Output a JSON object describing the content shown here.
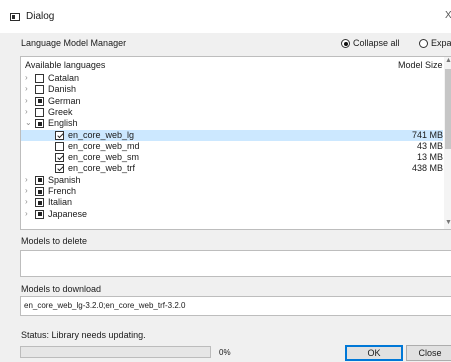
{
  "window": {
    "title": "Dialog",
    "close_glyph": "X"
  },
  "header": {
    "label": "Language Model Manager",
    "collapse_label": "Collapse all",
    "expand_label": "Expand all"
  },
  "tree": {
    "column_label": "Available languages",
    "column_size": "Model Size",
    "rows": [
      {
        "depth": 0,
        "chevron": ">",
        "check": "unchecked",
        "label": "Catalan",
        "size": ""
      },
      {
        "depth": 0,
        "chevron": ">",
        "check": "unchecked",
        "label": "Danish",
        "size": ""
      },
      {
        "depth": 0,
        "chevron": ">",
        "check": "partial",
        "label": "German",
        "size": ""
      },
      {
        "depth": 0,
        "chevron": ">",
        "check": "unchecked",
        "label": "Greek",
        "size": ""
      },
      {
        "depth": 0,
        "chevron": "v",
        "check": "partial",
        "label": "English",
        "size": ""
      },
      {
        "depth": 1,
        "chevron": "",
        "check": "checked",
        "label": "en_core_web_lg",
        "size": "741 MB",
        "selected": true
      },
      {
        "depth": 1,
        "chevron": "",
        "check": "unchecked",
        "label": "en_core_web_md",
        "size": "43 MB"
      },
      {
        "depth": 1,
        "chevron": "",
        "check": "checked",
        "label": "en_core_web_sm",
        "size": "13 MB"
      },
      {
        "depth": 1,
        "chevron": "",
        "check": "checked",
        "label": "en_core_web_trf",
        "size": "438 MB"
      },
      {
        "depth": 0,
        "chevron": ">",
        "check": "partial",
        "label": "Spanish",
        "size": ""
      },
      {
        "depth": 0,
        "chevron": ">",
        "check": "partial",
        "label": "French",
        "size": ""
      },
      {
        "depth": 0,
        "chevron": ">",
        "check": "partial",
        "label": "Italian",
        "size": ""
      },
      {
        "depth": 0,
        "chevron": ">",
        "check": "partial",
        "label": "Japanese",
        "size": ""
      }
    ]
  },
  "delete_section": {
    "label": "Models to delete",
    "value": ""
  },
  "download_section": {
    "label": "Models to download",
    "value": "en_core_web_lg-3.2.0;en_core_web_trf-3.2.0"
  },
  "status": {
    "text": "Status: Library needs updating."
  },
  "progress": {
    "value": 0,
    "text": "0%"
  },
  "buttons": {
    "ok": "OK",
    "close": "Close"
  },
  "colors": {
    "selection": "#cce8ff",
    "accent": "#0078d7"
  }
}
